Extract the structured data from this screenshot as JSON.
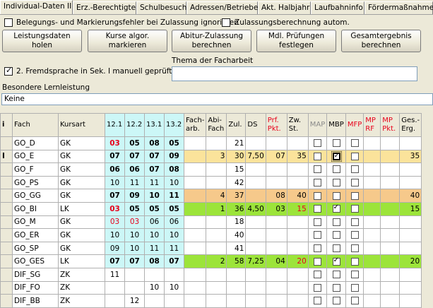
{
  "tabs": [
    "Individual-Daten II",
    "Erz.-Berechtigte",
    "Schulbesuch",
    "Adressen/Betriebe",
    "Akt. Halbjahr",
    "Laufbahninfo",
    "Fördermaßnahmen"
  ],
  "options": {
    "ignore_errors": "Belegungs- und Markierungsfehler bei Zulassung ignorieren",
    "auto_calc": "Zulassungsberechnung autom."
  },
  "buttons": {
    "get_data": "Leistungsdaten holen",
    "mark_courses": "Kurse algor.\nmarkieren",
    "calc_admission": "Abitur-Zulassung\nberechnen",
    "oral_exams": "Mdl. Prüfungen\nfestlegen",
    "total_result": "Gesamtergebnis\nberechnen"
  },
  "fremdsprache_label": "2. Fremdsprache in Sek. I manuell geprüft",
  "thema_label": "Thema der Facharbeit",
  "thema_value": "",
  "lernleistung_label": "Besondere Lernleistung",
  "lernleistung_value": "Keine",
  "table": {
    "headers": [
      "i",
      "Fach",
      "Kursart",
      "12.1",
      "12.2",
      "13.1",
      "13.2",
      "Fach-\narb.",
      "Abi-\nFach",
      "Zul.",
      "DS",
      "Prf.\nPkt.",
      "Zw.\nSt.",
      "MAP",
      "MBP",
      "MFP",
      "MP\nRF",
      "MP\nPkt.",
      "Ges.-\nErg."
    ],
    "rows": [
      {
        "cursor": "",
        "fach": "GO_D",
        "kurs": "GK",
        "g": [
          "03",
          "05",
          "08",
          "05"
        ],
        "gred": [
          true,
          false,
          false,
          false
        ],
        "facharb": "",
        "abi": "",
        "zul": "21",
        "ds": "",
        "prf": "",
        "zw": "",
        "map": false,
        "mbp": false,
        "mfp": false,
        "ges": "",
        "style": ""
      },
      {
        "cursor": "I",
        "fach": "GO_E",
        "kurs": "GK",
        "g": [
          "07",
          "07",
          "07",
          "09"
        ],
        "gred": [
          false,
          false,
          false,
          false
        ],
        "facharb": "",
        "abi": "3",
        "zul": "30",
        "ds": "7,50",
        "prf": "07",
        "zw": "35",
        "map": false,
        "mbp": true,
        "mfp": false,
        "ges": "35",
        "style": "yel",
        "mbpfocus": true
      },
      {
        "cursor": "",
        "fach": "GO_F",
        "kurs": "GK",
        "g": [
          "06",
          "06",
          "07",
          "08"
        ],
        "gred": [
          false,
          false,
          false,
          false
        ],
        "facharb": "",
        "abi": "",
        "zul": "15",
        "ds": "",
        "prf": "",
        "zw": "",
        "map": false,
        "mbp": false,
        "mfp": false,
        "ges": "",
        "style": "",
        "plain": true
      },
      {
        "cursor": "",
        "fach": "GO_PS",
        "kurs": "GK",
        "g": [
          "10",
          "11",
          "11",
          "10"
        ],
        "gred": [
          false,
          false,
          false,
          false
        ],
        "facharb": "",
        "abi": "",
        "zul": "42",
        "ds": "",
        "prf": "",
        "zw": "",
        "map": false,
        "mbp": false,
        "mfp": false,
        "ges": "",
        "style": "",
        "light": true
      },
      {
        "cursor": "",
        "fach": "GO_GG",
        "kurs": "GK",
        "g": [
          "07",
          "09",
          "10",
          "11"
        ],
        "gred": [
          false,
          false,
          false,
          false
        ],
        "facharb": "",
        "abi": "4",
        "zul": "37",
        "ds": "",
        "prf": "08",
        "zw": "40",
        "map": false,
        "mbp": false,
        "mfp": false,
        "ges": "40",
        "style": "org"
      },
      {
        "cursor": "",
        "fach": "GO_BI",
        "kurs": "LK",
        "g": [
          "03",
          "05",
          "05",
          "05"
        ],
        "gred": [
          true,
          false,
          false,
          false
        ],
        "facharb": "",
        "abi": "1",
        "zul": "36",
        "ds": "4,50",
        "prf": "03",
        "zw": "15",
        "zwred": true,
        "map": false,
        "mbp": true,
        "mfp": false,
        "ges": "15",
        "style": "grn"
      },
      {
        "cursor": "",
        "fach": "GO_M",
        "kurs": "GK",
        "g": [
          "03",
          "03",
          "06",
          "06"
        ],
        "gred": [
          true,
          true,
          false,
          false
        ],
        "facharb": "",
        "abi": "",
        "zul": "18",
        "ds": "",
        "prf": "",
        "zw": "",
        "map": false,
        "mbp": false,
        "mfp": false,
        "ges": "",
        "style": "",
        "light": true
      },
      {
        "cursor": "",
        "fach": "GO_ER",
        "kurs": "GK",
        "g": [
          "10",
          "10",
          "10",
          "10"
        ],
        "gred": [
          false,
          false,
          false,
          false
        ],
        "facharb": "",
        "abi": "",
        "zul": "40",
        "ds": "",
        "prf": "",
        "zw": "",
        "map": false,
        "mbp": false,
        "mfp": false,
        "ges": "",
        "style": "",
        "light": true
      },
      {
        "cursor": "",
        "fach": "GO_SP",
        "kurs": "GK",
        "g": [
          "09",
          "10",
          "11",
          "11"
        ],
        "gred": [
          false,
          false,
          false,
          false
        ],
        "facharb": "",
        "abi": "",
        "zul": "41",
        "ds": "",
        "prf": "",
        "zw": "",
        "map": false,
        "mbp": false,
        "mfp": false,
        "ges": "",
        "style": "",
        "light": true
      },
      {
        "cursor": "",
        "fach": "GO_GES",
        "kurs": "LK",
        "g": [
          "07",
          "07",
          "08",
          "07"
        ],
        "gred": [
          false,
          false,
          false,
          false
        ],
        "facharb": "",
        "abi": "2",
        "zul": "58",
        "ds": "7,25",
        "prf": "04",
        "zw": "20",
        "zwred": true,
        "map": false,
        "mbp": true,
        "mfp": false,
        "ges": "20",
        "style": "grn"
      },
      {
        "cursor": "",
        "fach": "DIF_SG",
        "kurs": "ZK",
        "g": [
          "11",
          "",
          "",
          ""
        ],
        "gred": [
          false,
          false,
          false,
          false
        ],
        "facharb": "",
        "abi": "",
        "zul": "",
        "ds": "",
        "prf": "",
        "zw": "",
        "map": false,
        "mbp": false,
        "mfp": false,
        "ges": "",
        "style": "",
        "empty": true
      },
      {
        "cursor": "",
        "fach": "DIF_FO",
        "kurs": "ZK",
        "g": [
          "",
          "",
          "10",
          "10"
        ],
        "gred": [
          false,
          false,
          false,
          false
        ],
        "facharb": "",
        "abi": "",
        "zul": "",
        "ds": "",
        "prf": "",
        "zw": "",
        "map": false,
        "mbp": false,
        "mfp": false,
        "ges": "",
        "style": "",
        "empty": true
      },
      {
        "cursor": "",
        "fach": "DIF_BB",
        "kurs": "ZK",
        "g": [
          "",
          "12",
          "",
          ""
        ],
        "gred": [
          false,
          false,
          false,
          false
        ],
        "facharb": "",
        "abi": "",
        "zul": "",
        "ds": "",
        "prf": "",
        "zw": "",
        "map": false,
        "mbp": false,
        "mfp": false,
        "ges": "",
        "style": "",
        "empty": true
      }
    ]
  },
  "colors": {
    "cyan": "#ccf7f7",
    "yellow": "#fbe39b",
    "orange": "#f6c98b",
    "green": "#9ce43a",
    "red": "#e8001a"
  }
}
